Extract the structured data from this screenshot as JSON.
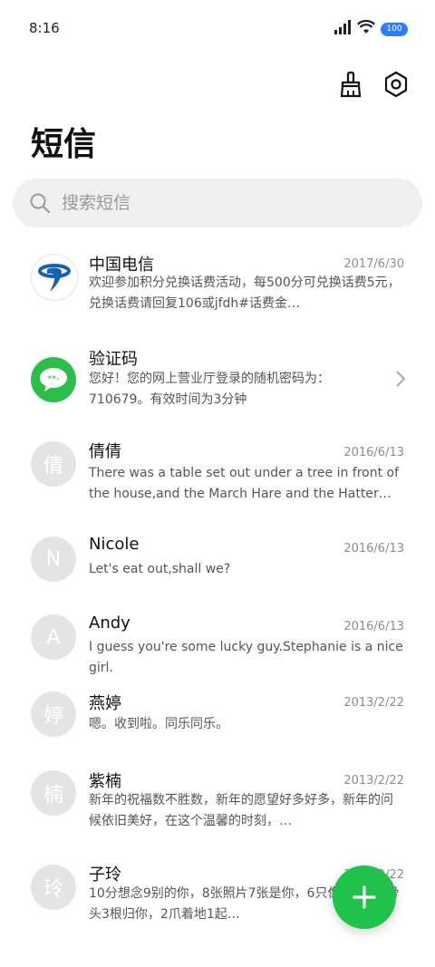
{
  "status_bar": {
    "time": "8:16",
    "battery": "100",
    "icons": [
      "signal-icon",
      "wifi-icon",
      "battery-icon"
    ]
  },
  "toolbar": {
    "icons": [
      "broom-icon",
      "settings-hexagon-icon"
    ]
  },
  "page": {
    "title": "短信"
  },
  "search": {
    "placeholder": "搜索短信",
    "value": ""
  },
  "conversations": [
    {
      "name": "中国电信",
      "date": "2017/6/30",
      "preview": "欢迎参加积分兑换话费活动，每500分可兑换话费5元，兑换话费请回复106或jfdh#话费金…",
      "avatar_type": "telecom-logo"
    },
    {
      "name": "验证码",
      "date": "",
      "preview": "您好！您的网上营业厅登录的随机密码为：710679。有效时间为3分钟",
      "avatar_type": "verification-code"
    },
    {
      "name": "倩倩",
      "date": "2016/6/13",
      "preview": "There was a table set out under a tree in front of the house,and the March Hare and the Hatter we…",
      "avatar_letter": "倩"
    },
    {
      "name": "Nicole",
      "date": "2016/6/13",
      "preview": "Let's eat out,shall we?",
      "avatar_letter": "N"
    },
    {
      "name": "Andy",
      "date": "2016/6/13",
      "preview": "I guess you're some lucky guy.Stephanie is a nice girl.",
      "avatar_letter": "A"
    },
    {
      "name": "燕婷",
      "date": "2013/2/22",
      "preview": "嗯。收到啦。同乐同乐。",
      "avatar_letter": "婷"
    },
    {
      "name": "紫楠",
      "date": "2013/2/22",
      "preview": "新年的祝福数不胜数，新年的愿望好多好多，新年的问候依旧美好，在这个温馨的时刻，…",
      "avatar_letter": "楠"
    },
    {
      "name": "子玲",
      "date": "2013/2/22",
      "preview": "10分想念9别的你，8张照片7张是你，6只像你，4根骨头3根归你，2爪着地1起…",
      "avatar_letter": "玲"
    }
  ],
  "colors": {
    "accent_green": "#1fc24b",
    "battery_blue": "#2f7cf6",
    "avatar_gray": "#e4e4e4"
  }
}
